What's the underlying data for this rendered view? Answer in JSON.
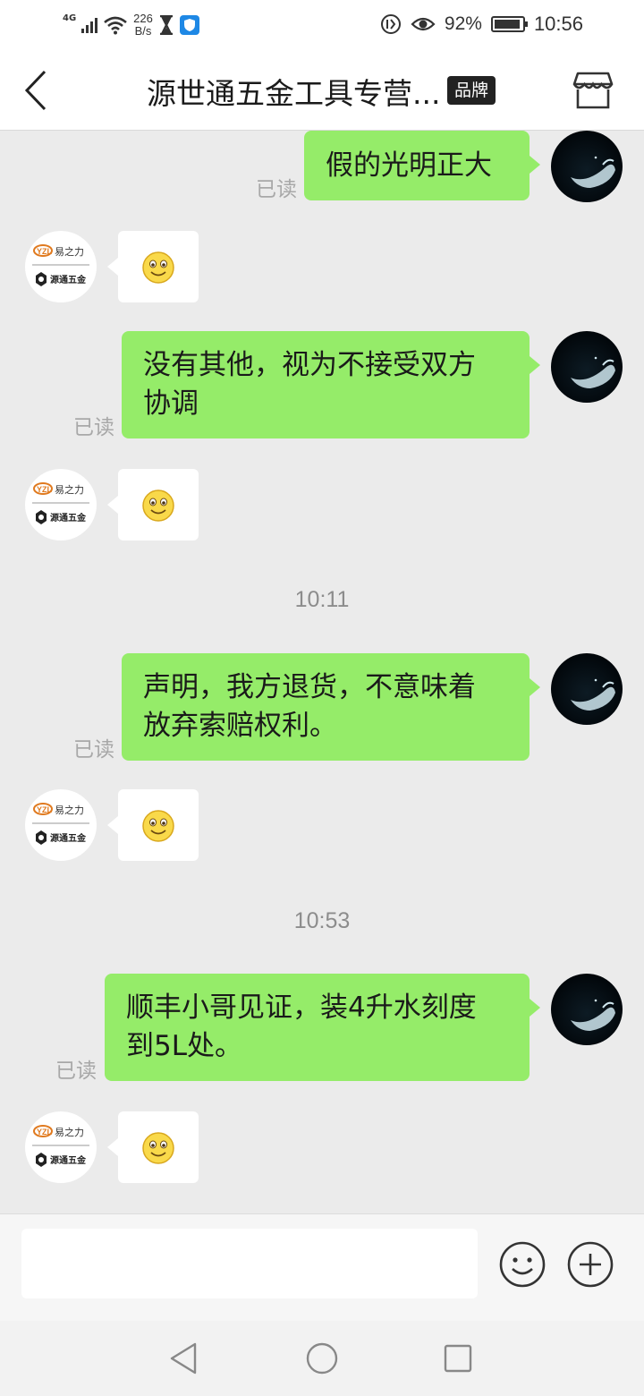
{
  "status_bar": {
    "network": "4G",
    "speed_value": "226",
    "speed_unit": "B/s",
    "battery": "92%",
    "time": "10:56"
  },
  "header": {
    "title": "源世通五金工具专营...",
    "badge": "品牌"
  },
  "shop_logo": {
    "brand_top": "易之力",
    "brand_bottom": "源通五金"
  },
  "messages": [
    {
      "sender": "self",
      "text": "假的光明正大",
      "read": "已读"
    },
    {
      "sender": "shop",
      "content": "smiley-emoji"
    },
    {
      "sender": "self",
      "text_lines": [
        "没有其他，视为不接受双方",
        "协调"
      ],
      "read": "已读"
    },
    {
      "sender": "shop",
      "content": "smiley-emoji"
    },
    {
      "timestamp": "10:11"
    },
    {
      "sender": "self",
      "text_lines": [
        "声明，我方退货，不意味着",
        "放弃索赔权利。"
      ],
      "read": "已读"
    },
    {
      "sender": "shop",
      "content": "smiley-emoji"
    },
    {
      "timestamp": "10:53"
    },
    {
      "sender": "self",
      "text_lines": [
        "顺丰小哥见证，装4升水刻度",
        "到5L处。"
      ],
      "read": "已读"
    },
    {
      "sender": "shop",
      "content": "smiley-emoji"
    }
  ],
  "input": {
    "placeholder": ""
  },
  "colors": {
    "self_bubble": "#95ec69",
    "background": "#ebebeb",
    "brand_badge": "#222222"
  }
}
